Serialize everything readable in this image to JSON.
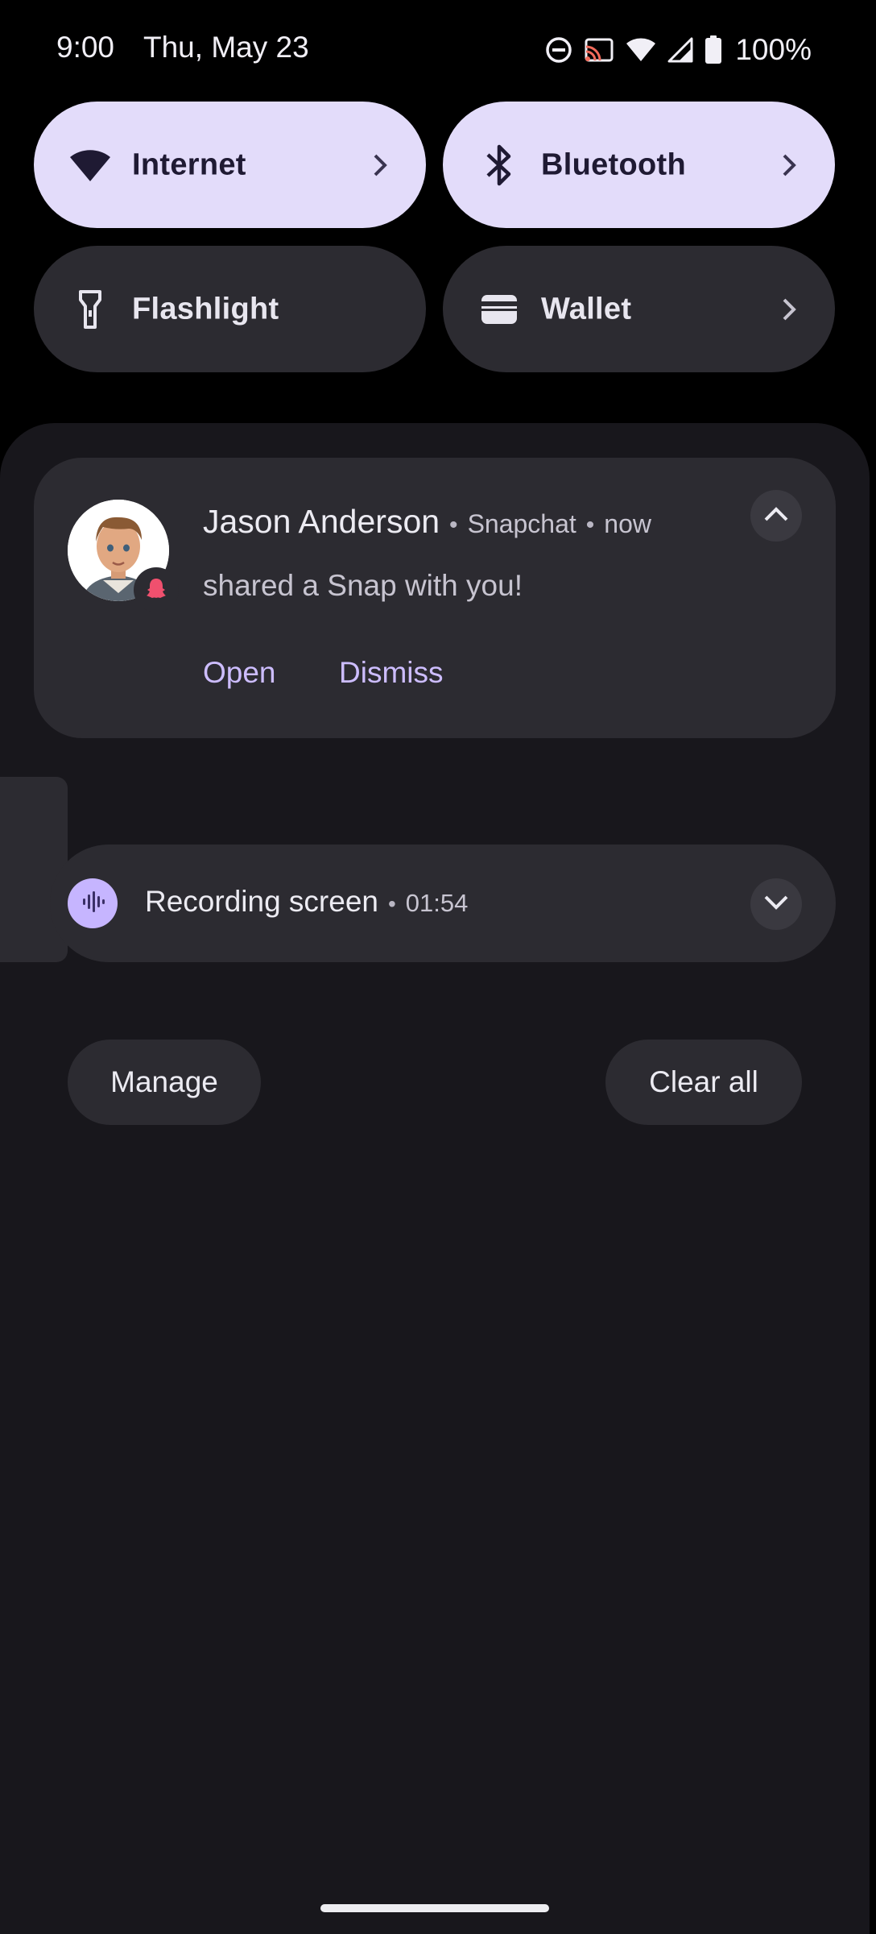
{
  "status_bar": {
    "time": "9:00",
    "date": "Thu, May 23",
    "icons": [
      "do-not-disturb-icon",
      "cast-icon",
      "wifi-icon",
      "cell-signal-icon",
      "battery-icon"
    ],
    "battery_percent": "100%"
  },
  "quick_settings": {
    "tiles": [
      {
        "label": "Internet",
        "icon": "wifi-icon",
        "state": "on",
        "has_chevron": true
      },
      {
        "label": "Bluetooth",
        "icon": "bluetooth-icon",
        "state": "on",
        "has_chevron": true
      },
      {
        "label": "Flashlight",
        "icon": "flashlight-icon",
        "state": "off",
        "has_chevron": false
      },
      {
        "label": "Wallet",
        "icon": "wallet-icon",
        "state": "off",
        "has_chevron": true
      }
    ]
  },
  "notifications": [
    {
      "sender": "Jason Anderson",
      "app": "Snapchat",
      "time": "now",
      "text": "shared a Snap with you!",
      "actions": [
        "Open",
        "Dismiss"
      ],
      "app_icon": "snapchat-ghost-icon"
    }
  ],
  "ongoing": {
    "title": "Recording screen",
    "elapsed": "01:54",
    "icon": "audio-waveform-icon"
  },
  "footer": {
    "manage_label": "Manage",
    "clear_all_label": "Clear all"
  },
  "colors": {
    "tile_on": "#e3dcfa",
    "tile_off": "#2c2b31",
    "accent": "#cdbdff",
    "snapchat_badge": "#f0506e",
    "shade_bg": "#18171c"
  }
}
